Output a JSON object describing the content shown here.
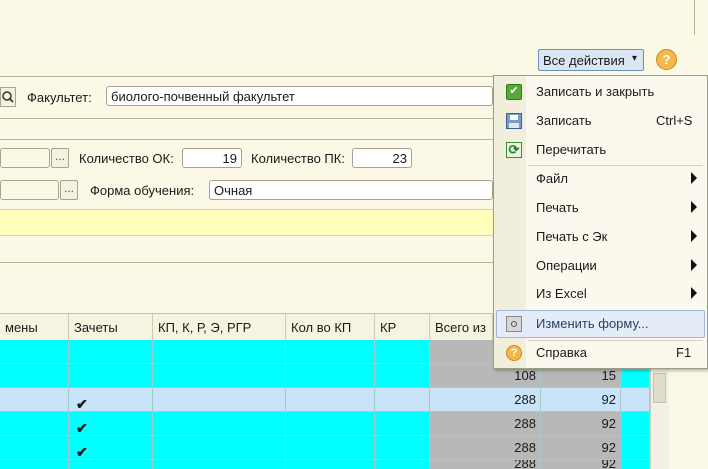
{
  "toolbar": {
    "all_actions": "Все действия",
    "all_actions_arrow": "▾",
    "help": "?"
  },
  "form": {
    "faculty_label": "Факультет:",
    "faculty_value": "биолого-почвенный факультет",
    "count_ok_label": "Количество ОК:",
    "count_ok_value": "19",
    "count_pk_label": "Количество ПК:",
    "count_pk_value": "23",
    "study_form_label": "Форма обучения:",
    "study_form_value": "Очная",
    "dots": "..."
  },
  "table": {
    "headers": [
      "мены",
      "Зачеты",
      "КП, К, Р, Э, РГР",
      "Кол во КП",
      "КР",
      "Всего из"
    ],
    "rows": [
      {
        "check": false,
        "total": "",
        "col7": ""
      },
      {
        "check": false,
        "total": "108",
        "col7": "15"
      },
      {
        "check": true,
        "total": "288",
        "col7": "92"
      },
      {
        "check": true,
        "total": "288",
        "col7": "92"
      },
      {
        "check": true,
        "total": "288",
        "col7": "92"
      },
      {
        "check": false,
        "total": "288",
        "col7": "92"
      }
    ],
    "check_glyph": "✔"
  },
  "menu": {
    "items": [
      {
        "label": "Записать и закрыть",
        "shortcut": "",
        "submenu": false,
        "icon": "save-close-icon"
      },
      {
        "label": "Записать",
        "shortcut": "Ctrl+S",
        "submenu": false,
        "icon": "floppy-disk-icon"
      },
      {
        "label": "Перечитать",
        "shortcut": "",
        "submenu": false,
        "icon": "reload-icon"
      },
      {
        "label": "Файл",
        "shortcut": "",
        "submenu": true,
        "icon": ""
      },
      {
        "label": "Печать",
        "shortcut": "",
        "submenu": true,
        "icon": ""
      },
      {
        "label": "Печать с Эк",
        "shortcut": "",
        "submenu": true,
        "icon": ""
      },
      {
        "label": "Операции",
        "shortcut": "",
        "submenu": true,
        "icon": ""
      },
      {
        "label": "Из Excel",
        "shortcut": "",
        "submenu": true,
        "icon": ""
      },
      {
        "label": "Изменить форму...",
        "shortcut": "",
        "submenu": false,
        "icon": "form-edit-icon"
      },
      {
        "label": "Справка",
        "shortcut": "F1",
        "submenu": false,
        "icon": "help-icon"
      }
    ]
  },
  "colors": {
    "background": "#fbf8e6",
    "cyan_cell": "#00ffff",
    "selected_row": "#c9e3f8",
    "gray_cell": "#b8b8b8",
    "yellow_band": "#ffffbb",
    "menu_highlight": "#e4ecf7"
  }
}
